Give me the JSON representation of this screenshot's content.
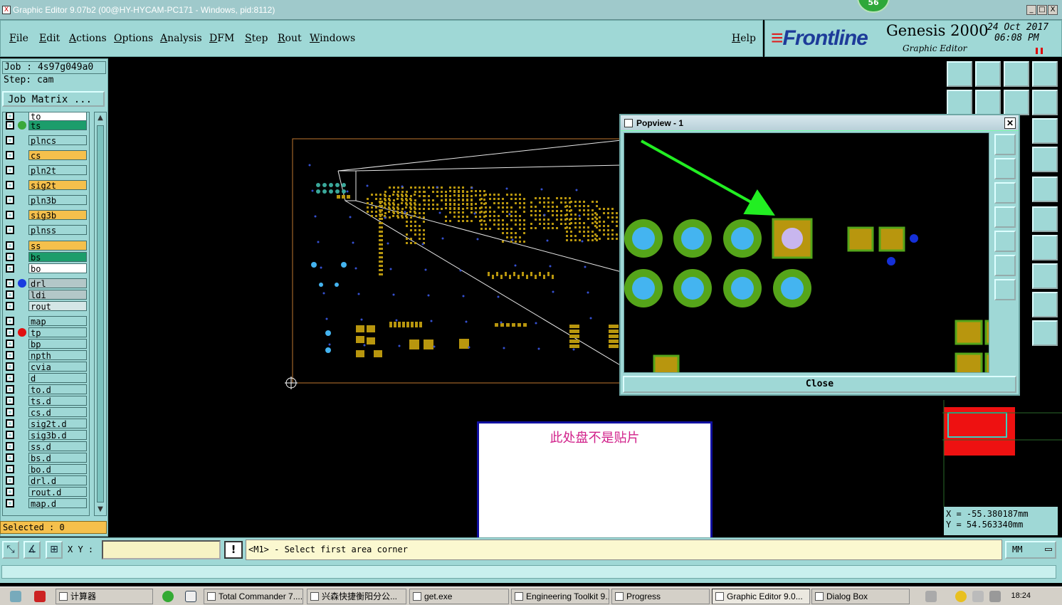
{
  "window": {
    "title": "Graphic Editor 9.07b2 (00@HY-HYCAM-PC171 - Windows, pid:8112)",
    "notification_count": "56",
    "controls": [
      "_",
      "□",
      "X"
    ]
  },
  "menu": {
    "items": [
      "File",
      "Edit",
      "Actions",
      "Options",
      "Analysis",
      "DFM",
      "Step",
      "Rout",
      "Windows"
    ],
    "help": "Help"
  },
  "brand": {
    "logo": "Frontline",
    "product": "Genesis 2000",
    "subtitle": "Graphic Editor",
    "date": "24 Oct 2017",
    "time": "06:08 PM"
  },
  "job": {
    "job_label": "Job : 4s97g049a0",
    "step_label": "Step: cam",
    "job_matrix": "Job Matrix ...",
    "selected": "Selected : 0"
  },
  "layers": [
    {
      "name": "to",
      "bg": "#ffffff",
      "dot": ""
    },
    {
      "name": "ts",
      "bg": "#1c9d6b",
      "dot": "#3aa83a"
    },
    {
      "name": "plncs",
      "bg": "#9fd8d6",
      "dot": ""
    },
    {
      "name": "cs",
      "bg": "#f5c04c",
      "dot": ""
    },
    {
      "name": "pln2t",
      "bg": "#9fd8d6",
      "dot": ""
    },
    {
      "name": "sig2t",
      "bg": "#f5c04c",
      "dot": ""
    },
    {
      "name": "pln3b",
      "bg": "#9fd8d6",
      "dot": ""
    },
    {
      "name": "sig3b",
      "bg": "#f5c04c",
      "dot": ""
    },
    {
      "name": "plnss",
      "bg": "#9fd8d6",
      "dot": ""
    },
    {
      "name": "ss",
      "bg": "#f5c04c",
      "dot": ""
    },
    {
      "name": "bs",
      "bg": "#1c9d6b",
      "dot": ""
    },
    {
      "name": "bo",
      "bg": "#ffffff",
      "dot": ""
    },
    {
      "name": "drl",
      "bg": "#b3c7c8",
      "dot": "#1a3de0"
    },
    {
      "name": "ldi",
      "bg": "#b3c7c8",
      "dot": ""
    },
    {
      "name": "rout",
      "bg": "#d4e6e6",
      "dot": ""
    },
    {
      "name": "map",
      "bg": "#9fd8d6",
      "dot": ""
    },
    {
      "name": "tp",
      "bg": "#9fd8d6",
      "dot": "#e01010"
    },
    {
      "name": "bp",
      "bg": "#9fd8d6",
      "dot": ""
    },
    {
      "name": "npth",
      "bg": "#9fd8d6",
      "dot": ""
    },
    {
      "name": "cvia",
      "bg": "#9fd8d6",
      "dot": ""
    },
    {
      "name": "d",
      "bg": "#9fd8d6",
      "dot": ""
    },
    {
      "name": "to.d",
      "bg": "#9fd8d6",
      "dot": ""
    },
    {
      "name": "ts.d",
      "bg": "#9fd8d6",
      "dot": ""
    },
    {
      "name": "cs.d",
      "bg": "#9fd8d6",
      "dot": ""
    },
    {
      "name": "sig2t.d",
      "bg": "#9fd8d6",
      "dot": ""
    },
    {
      "name": "sig3b.d",
      "bg": "#9fd8d6",
      "dot": ""
    },
    {
      "name": "ss.d",
      "bg": "#9fd8d6",
      "dot": ""
    },
    {
      "name": "bs.d",
      "bg": "#9fd8d6",
      "dot": ""
    },
    {
      "name": "bo.d",
      "bg": "#9fd8d6",
      "dot": ""
    },
    {
      "name": "drl.d",
      "bg": "#9fd8d6",
      "dot": ""
    },
    {
      "name": "rout.d",
      "bg": "#9fd8d6",
      "dot": ""
    },
    {
      "name": "map.d",
      "bg": "#9fd8d6",
      "dot": ""
    }
  ],
  "command": {
    "xy_label": "X Y :",
    "xy_value": "",
    "prompt": "<M1> - Select first area corner",
    "units": "MM"
  },
  "coords": {
    "x": "X = -55.380187mm",
    "y": "Y =  54.563340mm"
  },
  "popview": {
    "title": "Popview - 1",
    "close_label": "Close"
  },
  "note": {
    "text": "此处盘不是贴片"
  },
  "taskbar": {
    "tasks": [
      "计算器",
      "Total Commander 7....",
      "兴森快捷衡阳分公...",
      "get.exe",
      "Engineering Toolkit 9....",
      "Progress",
      "Graphic Editor 9.0...",
      "Dialog Box"
    ],
    "active_task": "Graphic Editor 9.0...",
    "clock": "18:24"
  },
  "colors": {
    "panel": "#9fd8d6",
    "pad": "#b8960e",
    "pad_ring": "#55a51a",
    "drill": "#44b4f0",
    "arrow": "#22ee22",
    "note_text": "#d1208a"
  }
}
